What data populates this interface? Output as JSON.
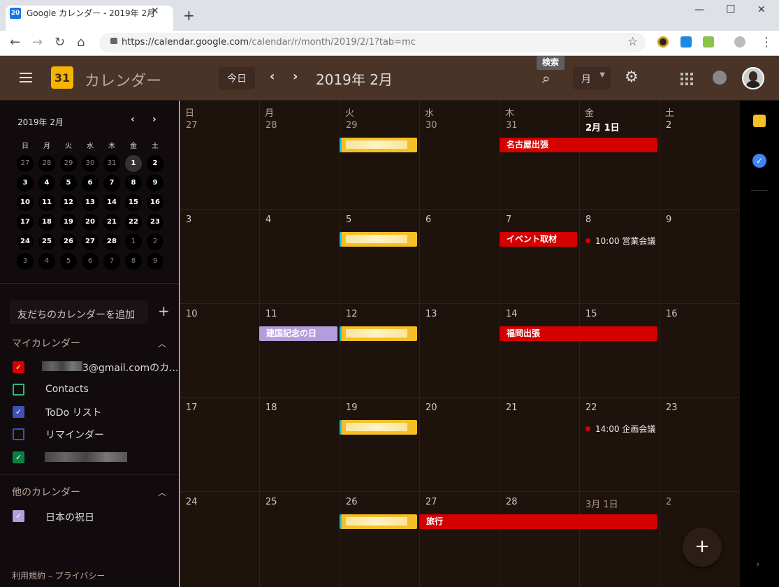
{
  "browser": {
    "tab_title": "Google カレンダー - 2019年 2月",
    "tab_favicon": "20",
    "url_host": "https://calendar.google.com",
    "url_path": "/calendar/r/month/2019/2/1?tab=mc"
  },
  "header": {
    "app_name": "カレンダー",
    "logo_text": "31",
    "today_label": "今日",
    "period": "2019年 2月",
    "search_tooltip": "検索",
    "view_label": "月"
  },
  "mini_calendar": {
    "title": "2019年 2月",
    "weekdays": [
      "日",
      "月",
      "火",
      "水",
      "木",
      "金",
      "土"
    ],
    "days": [
      "27",
      "28",
      "29",
      "30",
      "31",
      "1",
      "2",
      "3",
      "4",
      "5",
      "6",
      "7",
      "8",
      "9",
      "10",
      "11",
      "12",
      "13",
      "14",
      "15",
      "16",
      "17",
      "18",
      "19",
      "20",
      "21",
      "22",
      "23",
      "24",
      "25",
      "26",
      "27",
      "28",
      "1",
      "2",
      "3",
      "4",
      "5",
      "6",
      "7",
      "8",
      "9"
    ]
  },
  "sidebar": {
    "add_calendar": "友だちのカレンダーを追加",
    "my_calendars_title": "マイカレンダー",
    "my_calendars": [
      {
        "label": "3@gmail.comのカ..."
      },
      {
        "label": "Contacts"
      },
      {
        "label": "ToDo リスト"
      },
      {
        "label": "リマインダー"
      }
    ],
    "other_calendars_title": "他のカレンダー",
    "other_calendars": [
      {
        "label": "日本の祝日"
      }
    ],
    "footer": "利用規約 – プライバシー"
  },
  "grid": {
    "weekdays": [
      "日",
      "月",
      "火",
      "水",
      "木",
      "金",
      "土"
    ],
    "weeks": [
      [
        "27",
        "28",
        "29",
        "30",
        "31",
        "2月 1日",
        "2"
      ],
      [
        "3",
        "4",
        "5",
        "6",
        "7",
        "8",
        "9"
      ],
      [
        "10",
        "11",
        "12",
        "13",
        "14",
        "15",
        "16"
      ],
      [
        "17",
        "18",
        "19",
        "20",
        "21",
        "22",
        "23"
      ],
      [
        "24",
        "25",
        "26",
        "27",
        "28",
        "3月 1日",
        "2"
      ]
    ],
    "events": {
      "nagoya": "名古屋出張",
      "event_coverage": "イベント取材",
      "sales_meeting": "10:00 営業会議",
      "national_day": "建国記念の日",
      "fukuoka": "福岡出張",
      "planning_meeting": "14:00 企画会議",
      "trip": "旅行"
    }
  },
  "colors": {
    "header_bg": "#4a3428",
    "grid_bg": "#1e120d",
    "event_red": "#d50000",
    "event_yellow": "#f6bf26",
    "event_lavender": "#b39ddb"
  }
}
